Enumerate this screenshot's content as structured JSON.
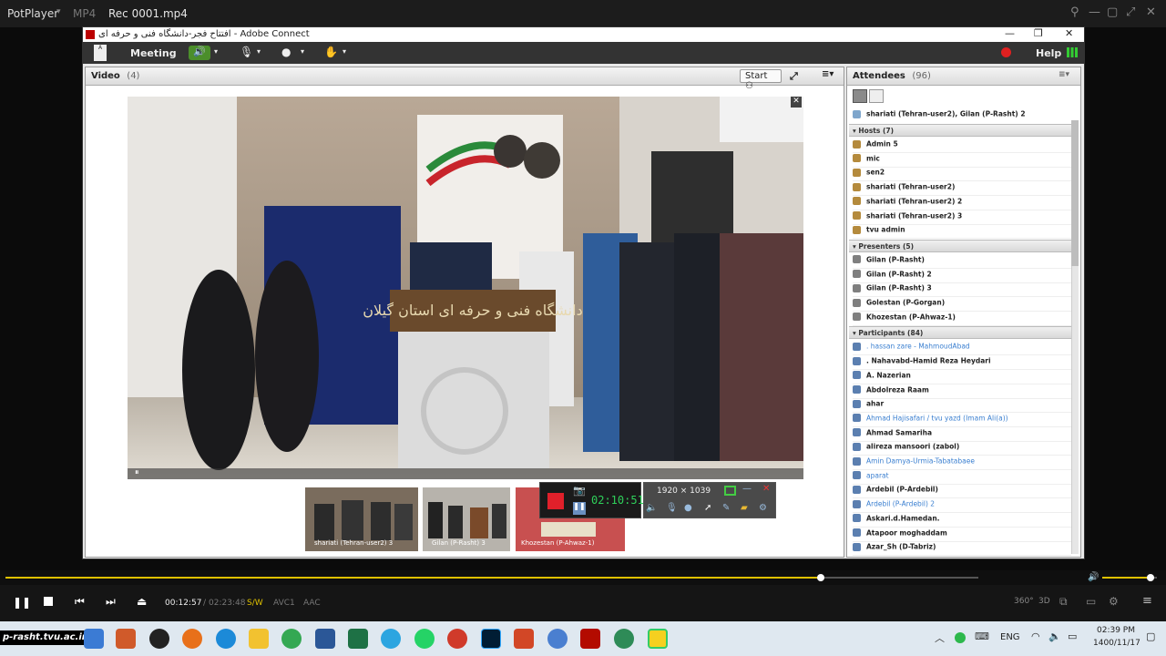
{
  "potplayer": {
    "app_name": "PotPlayer",
    "format": "MP4",
    "file_name": "Rec 0001.mp4"
  },
  "adobe_connect": {
    "window_title": "افتتاح فجر-دانشگاه فنی و حرفه ای - Adobe Connect",
    "menu": {
      "meeting": "Meeting",
      "help": "Help"
    },
    "video_pod": {
      "title": "Video",
      "count": "(4)",
      "start_label": "Start",
      "banner_text": "دانشگاه فنی و حرفه ای استان گیلان",
      "thumbnails": [
        "shariati (Tehran-user2) 3",
        "Gilan (P-Rasht) 3",
        "Khozestan (P-Ahwaz-1)"
      ]
    },
    "attendees_pod": {
      "title": "Attendees",
      "count": "(96)",
      "speaking": "shariati (Tehran-user2), Gilan (P-Rasht) 2",
      "hosts_header": "Hosts (7)",
      "hosts": [
        "Admin 5",
        "mic",
        "sen2",
        "shariati (Tehran-user2)",
        "shariati (Tehran-user2) 2",
        "shariati (Tehran-user2) 3",
        "tvu admin"
      ],
      "presenters_header": "Presenters (5)",
      "presenters": [
        "Gilan (P-Rasht)",
        "Gilan (P-Rasht) 2",
        "Gilan (P-Rasht) 3",
        "Golestan (P-Gorgan)",
        "Khozestan (P-Ahwaz-1)"
      ],
      "participants_header": "Participants (84)",
      "participants": [
        ". hassan zare - MahmoudAbad",
        ". Nahavabd-Hamid Reza Heydari",
        "A. Nazerian",
        "Abdolreza Raam",
        "ahar",
        "Ahmad Hajisafari / tvu yazd (Imam Ali(a))",
        "Ahmad Samariha",
        "alireza mansoori (zabol)",
        "Amin Damya-Urmia-Tabatabaee",
        "aparat",
        "Ardebil (P-Ardebil)",
        "Ardebil (P-Ardebil) 2",
        "Askari.d.Hamedan.",
        "Atapoor moghaddam",
        "Azar_Sh (D-Tabriz)"
      ],
      "blue_participants": [
        0,
        5,
        8,
        9,
        11
      ]
    }
  },
  "recorder": {
    "timer": "02:10:51",
    "resolution": "1920 × 1039"
  },
  "player": {
    "current_time": "00:12:57",
    "total_time": "02:23:48",
    "mode": "S/W",
    "video_codec": "AVC1",
    "audio_codec": "AAC",
    "progress": 0.838,
    "volume": 0.88,
    "btn_360": "360°",
    "btn_3d": "3D"
  },
  "taskbar": {
    "watermark": "p-rasht.tvu.ac.ir",
    "language": "ENG",
    "time": "02:39 PM",
    "date": "1400/11/17"
  },
  "colors": {
    "accent_yellow": "#e0c200",
    "link_blue": "#3a7fd0",
    "record_red": "#e0202a"
  }
}
